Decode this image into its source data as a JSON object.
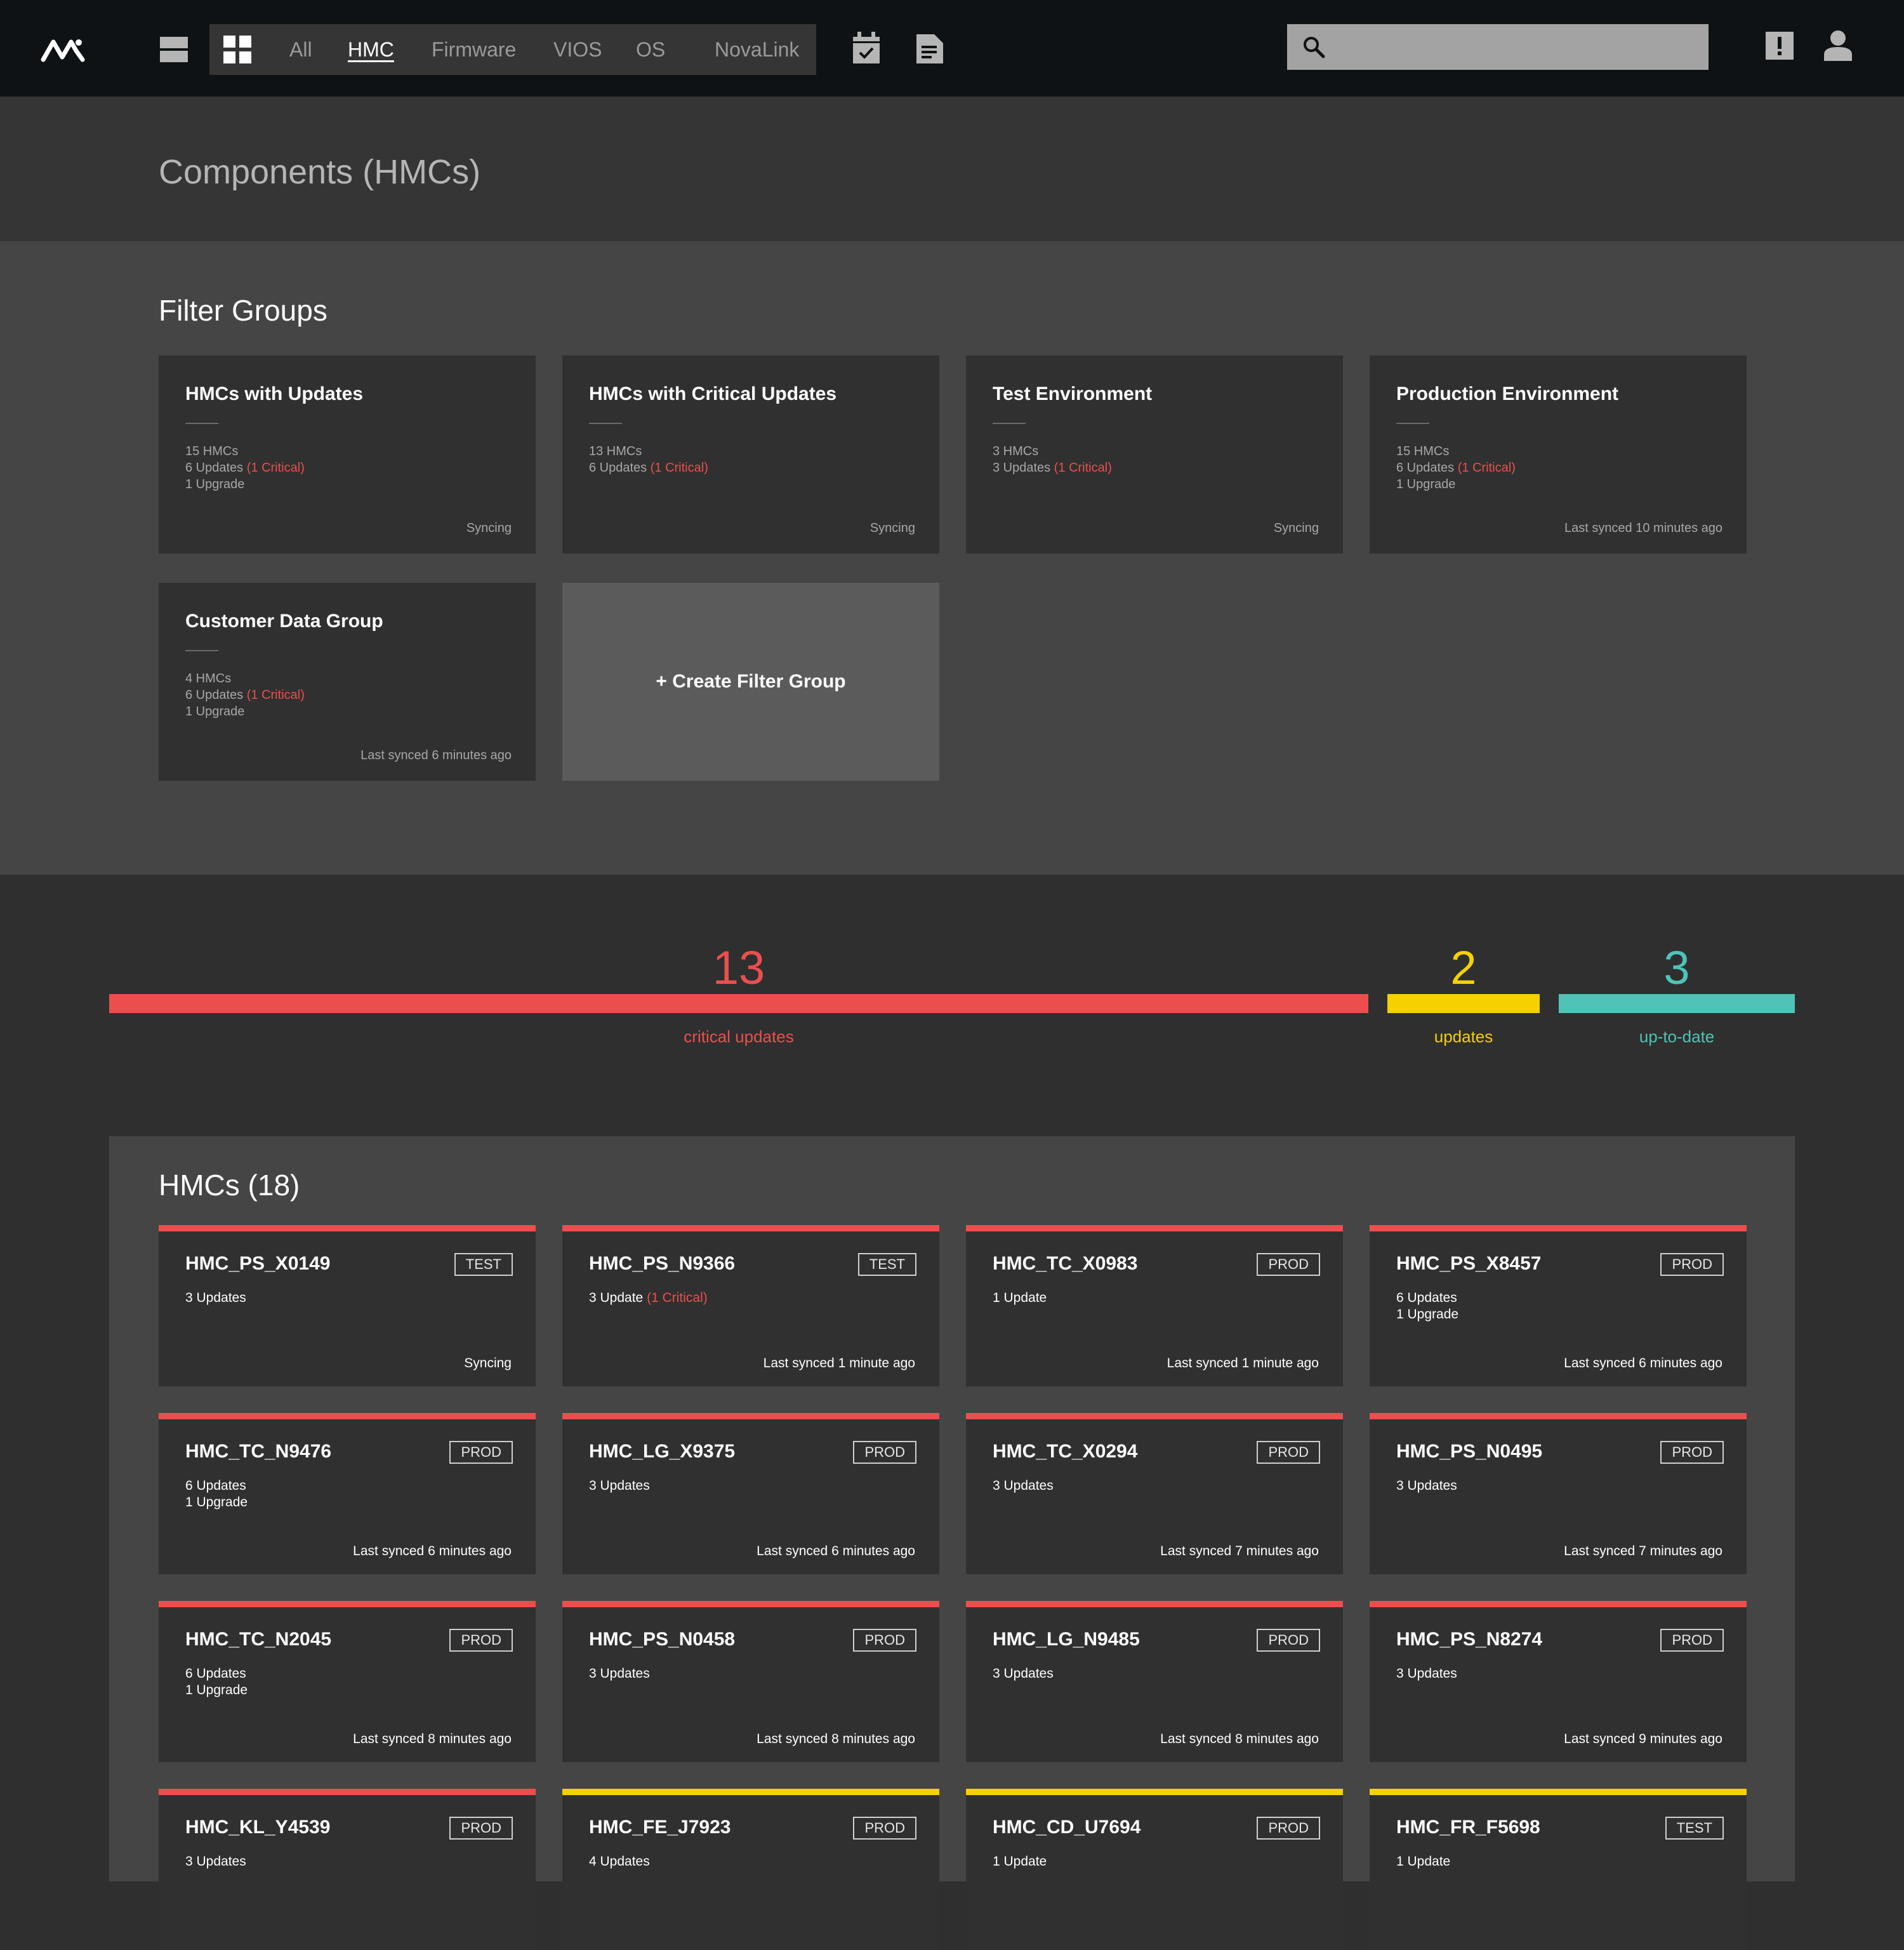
{
  "nav": {
    "tabs": [
      {
        "label": "All"
      },
      {
        "label": "HMC"
      },
      {
        "label": "Firmware"
      },
      {
        "label": "VIOS"
      },
      {
        "label": "OS"
      },
      {
        "label": "NovaLink"
      }
    ],
    "active_tab": "HMC",
    "search_placeholder": ""
  },
  "page": {
    "title": "Components (HMCs)"
  },
  "filter_groups": {
    "title": "Filter Groups",
    "cards": [
      {
        "name": "HMCs with Updates",
        "line1": "15 HMCs",
        "updates": "6 Updates",
        "critical": "(1 Critical)",
        "line3": "1 Upgrade",
        "status": "Syncing"
      },
      {
        "name": "HMCs with Critical Updates",
        "line1": "13 HMCs",
        "updates": "6 Updates",
        "critical": "(1 Critical)",
        "line3": "",
        "status": "Syncing"
      },
      {
        "name": "Test Environment",
        "line1": "3 HMCs",
        "updates": "3 Updates",
        "critical": "(1 Critical)",
        "line3": "",
        "status": "Syncing"
      },
      {
        "name": "Production Environment",
        "line1": "15 HMCs",
        "updates": "6 Updates",
        "critical": "(1 Critical)",
        "line3": "1 Upgrade",
        "status": "Last synced 10 minutes ago"
      },
      {
        "name": "Customer Data Group",
        "line1": "4 HMCs",
        "updates": "6 Updates",
        "critical": "(1 Critical)",
        "line3": "1 Upgrade",
        "status": "Last synced 6 minutes ago"
      }
    ],
    "create_label": "+ Create Filter Group"
  },
  "summary": {
    "critical": {
      "count": "13",
      "label": "critical updates",
      "color": "#ec4e4e"
    },
    "updates": {
      "count": "2",
      "label": "updates",
      "color": "#f5d100"
    },
    "uptodate": {
      "count": "3",
      "label": "up-to-date",
      "color": "#4fc3b7"
    }
  },
  "hmcs": {
    "title": "HMCs (18)",
    "items": [
      {
        "name": "HMC_PS_X0149",
        "tag": "TEST",
        "line1": "3 Updates",
        "critical": "",
        "line2": "",
        "status": "Syncing",
        "level": "critical"
      },
      {
        "name": "HMC_PS_N9366",
        "tag": "TEST",
        "line1": "3 Update",
        "critical": "(1 Critical)",
        "line2": "",
        "status": "Last synced 1 minute ago",
        "level": "critical"
      },
      {
        "name": "HMC_TC_X0983",
        "tag": "PROD",
        "line1": "1 Update",
        "critical": "",
        "line2": "",
        "status": "Last synced 1 minute ago",
        "level": "critical"
      },
      {
        "name": "HMC_PS_X8457",
        "tag": "PROD",
        "line1": "6 Updates",
        "critical": "",
        "line2": "1 Upgrade",
        "status": "Last synced 6 minutes ago",
        "level": "critical"
      },
      {
        "name": "HMC_TC_N9476",
        "tag": "PROD",
        "line1": "6 Updates",
        "critical": "",
        "line2": "1 Upgrade",
        "status": "Last synced 6 minutes ago",
        "level": "critical"
      },
      {
        "name": "HMC_LG_X9375",
        "tag": "PROD",
        "line1": "3 Updates",
        "critical": "",
        "line2": "",
        "status": "Last synced 6 minutes ago",
        "level": "critical"
      },
      {
        "name": "HMC_TC_X0294",
        "tag": "PROD",
        "line1": "3 Updates",
        "critical": "",
        "line2": "",
        "status": "Last synced 7 minutes ago",
        "level": "critical"
      },
      {
        "name": "HMC_PS_N0495",
        "tag": "PROD",
        "line1": "3 Updates",
        "critical": "",
        "line2": "",
        "status": "Last synced 7 minutes ago",
        "level": "critical"
      },
      {
        "name": "HMC_TC_N2045",
        "tag": "PROD",
        "line1": "6 Updates",
        "critical": "",
        "line2": "1 Upgrade",
        "status": "Last synced 8 minutes ago",
        "level": "critical"
      },
      {
        "name": "HMC_PS_N0458",
        "tag": "PROD",
        "line1": "3 Updates",
        "critical": "",
        "line2": "",
        "status": "Last synced 8 minutes ago",
        "level": "critical"
      },
      {
        "name": "HMC_LG_N9485",
        "tag": "PROD",
        "line1": "3 Updates",
        "critical": "",
        "line2": "",
        "status": "Last synced 8 minutes ago",
        "level": "critical"
      },
      {
        "name": "HMC_PS_N8274",
        "tag": "PROD",
        "line1": "3 Updates",
        "critical": "",
        "line2": "",
        "status": "Last synced 9 minutes ago",
        "level": "critical"
      },
      {
        "name": "HMC_KL_Y4539",
        "tag": "PROD",
        "line1": "3 Updates",
        "critical": "",
        "line2": "",
        "status": "",
        "level": "critical"
      },
      {
        "name": "HMC_FE_J7923",
        "tag": "PROD",
        "line1": "4 Updates",
        "critical": "",
        "line2": "",
        "status": "",
        "level": "update"
      },
      {
        "name": "HMC_CD_U7694",
        "tag": "PROD",
        "line1": "1 Update",
        "critical": "",
        "line2": "",
        "status": "",
        "level": "update"
      },
      {
        "name": "HMC_FR_F5698",
        "tag": "TEST",
        "line1": "1 Update",
        "critical": "",
        "line2": "",
        "status": "",
        "level": "update"
      }
    ]
  },
  "colors": {
    "critical": "#ec4e4e",
    "update": "#f5d100",
    "uptodate": "#4fc3b7"
  },
  "icons": [
    "logo",
    "list-view-icon",
    "grid-view-icon",
    "calendar-check-icon",
    "document-icon",
    "search-icon",
    "alert-icon",
    "user-icon"
  ]
}
